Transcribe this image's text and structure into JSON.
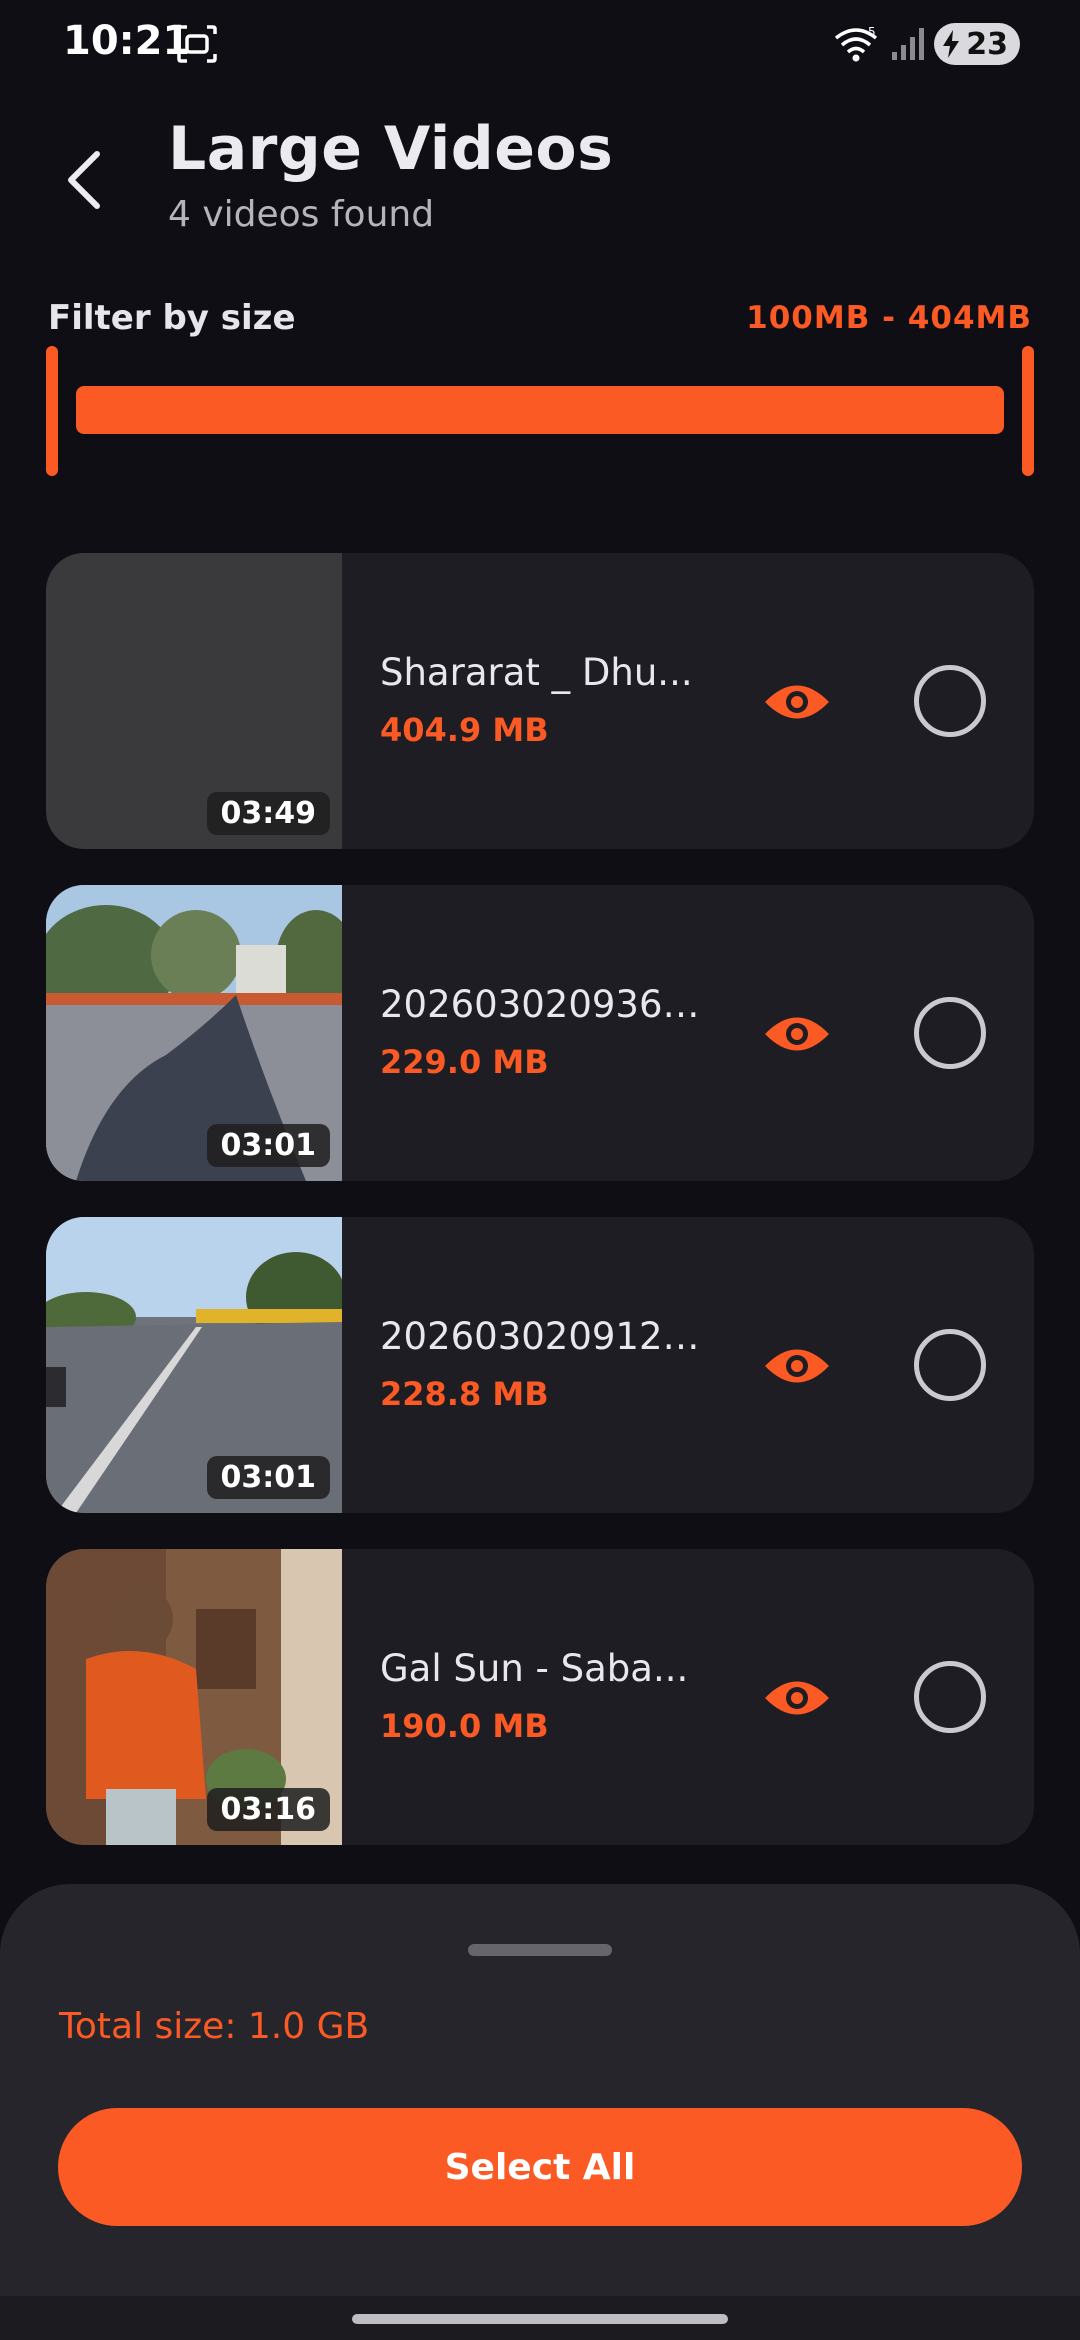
{
  "status_bar": {
    "time": "10:21",
    "battery": "23",
    "wifi_badge": "5",
    "icons": [
      "screenshot-icon",
      "wifi-icon",
      "signal-icon",
      "charging-bolt-icon"
    ]
  },
  "header": {
    "title": "Large Videos",
    "subtitle": "4 videos found",
    "back_icon": "chevron-left-icon"
  },
  "filter": {
    "label": "Filter by size",
    "range_text": "100MB - 404MB",
    "slider_min_fraction": 0.0,
    "slider_max_fraction": 1.0
  },
  "videos": [
    {
      "name": "Shararat _ Dhu...",
      "size": "404.9 MB",
      "duration": "03:49",
      "thumbnail": "blank-dark",
      "selected": false
    },
    {
      "name": "2026030209364...",
      "size": "229.0 MB",
      "duration": "03:01",
      "thumbnail": "street-shadow",
      "selected": false
    },
    {
      "name": "2026030209120...",
      "size": "228.8 MB",
      "duration": "03:01",
      "thumbnail": "road-trees",
      "selected": false
    },
    {
      "name": "Gal Sun - Saba...",
      "size": "190.0 MB",
      "duration": "03:16",
      "thumbnail": "person-orange-jacket",
      "selected": false
    }
  ],
  "footer": {
    "total_size": "Total size: 1.0 GB",
    "select_all": "Select All"
  },
  "colors": {
    "accent": "#fb5a24",
    "background": "#0f0e15",
    "card": "#1e1d23",
    "sheet": "#26252c"
  }
}
